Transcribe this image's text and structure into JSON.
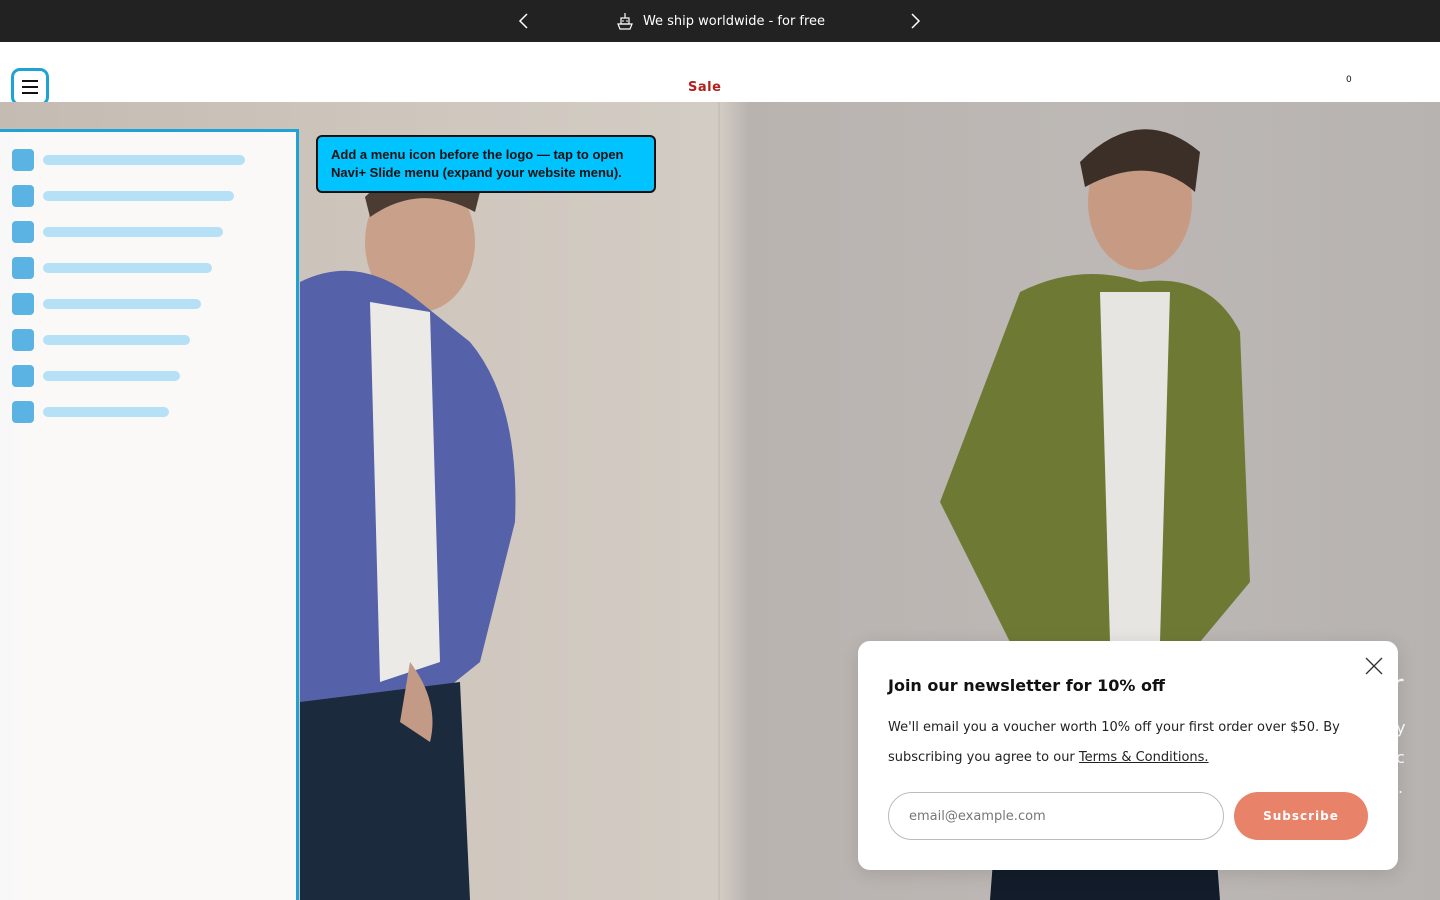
{
  "announcement": {
    "message": "We ship worldwide - for free",
    "prev_icon": "chevron-left-icon",
    "next_icon": "chevron-right-icon",
    "message_icon": "ship-icon"
  },
  "header": {
    "nav_link": "Sale",
    "cart_count": "0",
    "menu_icon": "hamburger-icon"
  },
  "slide_menu": {
    "accent_color": "#1fa2d6",
    "item_count": 8
  },
  "tooltip": {
    "text": "Add a menu icon before the logo — tap to open Navi+ Slide menu (expand your website menu)."
  },
  "newsletter": {
    "title": "Join our newsletter for 10% off",
    "description": "We'll email you a voucher worth 10% off your first order over $50. By subscribing you agree to our",
    "terms_link": "Terms & Conditions.",
    "email_placeholder": "email@example.com",
    "subscribe_label": "Subscribe",
    "button_color": "#e8836a"
  }
}
